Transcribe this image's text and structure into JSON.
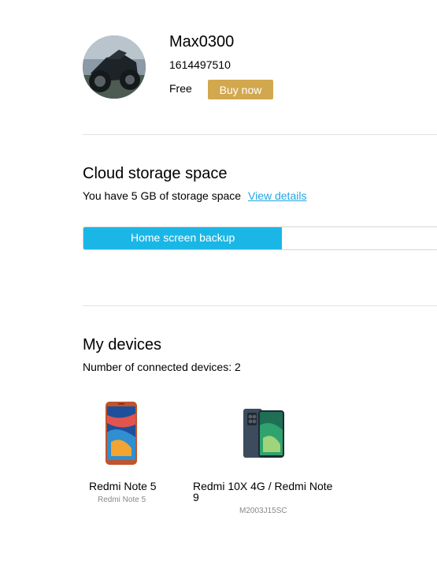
{
  "profile": {
    "username": "Max0300",
    "user_id": "1614497510",
    "plan": "Free",
    "buy_label": "Buy now"
  },
  "cloud": {
    "title": "Cloud storage space",
    "description": "You have 5 GB of storage space",
    "view_details_label": "View details",
    "bar_label": "Home screen backup",
    "bar_fraction": 0.56,
    "bar_color": "#1ab7e6"
  },
  "devices": {
    "title": "My devices",
    "count_text": "Number of connected devices: 2",
    "items": [
      {
        "name": "Redmi Note 5",
        "model": "Redmi Note 5"
      },
      {
        "name": "Redmi 10X 4G / Redmi Note 9",
        "model": "M2003J15SC"
      }
    ]
  },
  "colors": {
    "accent_gold": "#d2a84f",
    "link_blue": "#22a7e1"
  }
}
